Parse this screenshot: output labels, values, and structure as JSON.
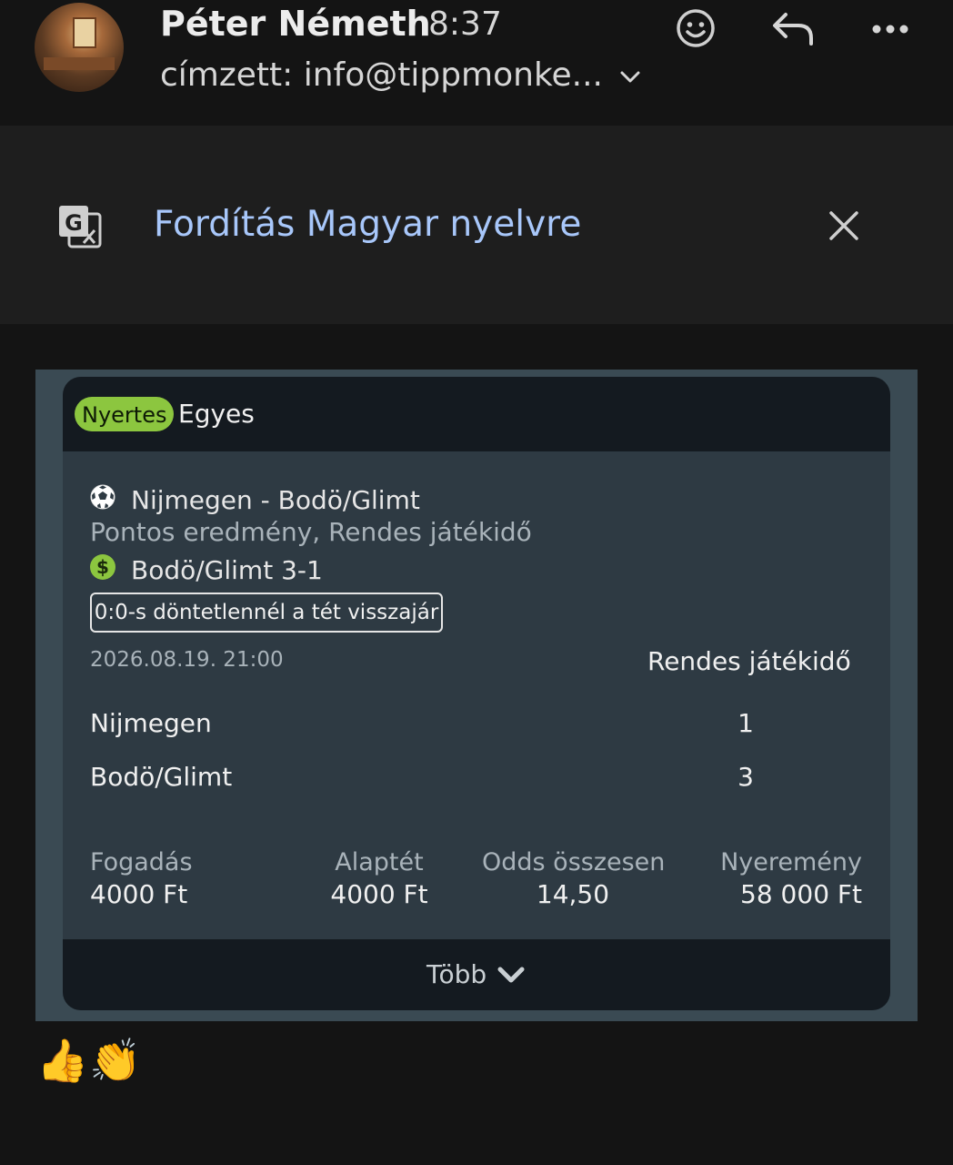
{
  "header": {
    "sender": "Péter Németh",
    "time": "8:37",
    "recipient": "címzett: info@tippmonke..."
  },
  "translate": {
    "label": "Fordítás Magyar nyelvre"
  },
  "bet": {
    "status": "Nyertes",
    "type": "Egyes",
    "match": "Nijmegen - Bodö/Glimt",
    "market": "Pontos eredmény, Rendes játékidő",
    "selection": "Bodö/Glimt 3-1",
    "refund_note": "0:0-s döntetlennél a tét visszajár",
    "datetime": "2026.08.19.  21:00",
    "period": "Rendes játékidő",
    "teams": [
      {
        "name": "Nijmegen",
        "score": "1"
      },
      {
        "name": "Bodö/Glimt",
        "score": "3"
      }
    ],
    "summary": {
      "stake_label": "Fogadás",
      "stake_value": "4000 Ft",
      "base_label": "Alaptét",
      "base_value": "4000 Ft",
      "odds_label": "Odds összesen",
      "odds_value": "14,50",
      "win_label": "Nyeremény",
      "win_value": "58 000 Ft"
    },
    "more": "Több"
  },
  "reactions": [
    "👍",
    "👏"
  ],
  "colors": {
    "accent_link": "#a8c7fa",
    "badge_green": "#8cc63f",
    "card_bg": "#2e3a43"
  }
}
